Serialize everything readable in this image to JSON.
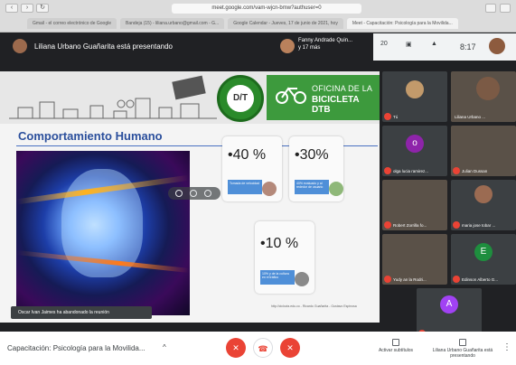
{
  "browser": {
    "url": "meet.google.com/vam-wjcn-bmw?authuser=0",
    "tabs": [
      "Gmail - el correo electrónico de Google",
      "Bandeja (15) - liliana.urbano@gmail.com - G...",
      "Google Calendar - Jueves, 17 de junio de 2021, hoy",
      "Meet - Capacitación: Psicología para la Movilida..."
    ]
  },
  "meet_top": {
    "presenting": "Liliana Urbano Guañarita está presentando",
    "others": "Fanny Andrade Quin...\ny 17 más",
    "right_count": "20",
    "time": "8:17"
  },
  "slide": {
    "office_line1": "OFICINA DE LA",
    "office_line2": "BICICLETA DTB",
    "logo": "D/T",
    "title": "Comportamiento Humano",
    "stats": [
      {
        "value": "•40 %",
        "caption": "Tomada de velocidad"
      },
      {
        "value": "•30%",
        "caption": "40% evaluado y al rededor de usuario"
      },
      {
        "value": "•10 %",
        "caption": "10% y de la cultura en el tráfico"
      }
    ],
    "credit": "http://ciclovia.edu.co - Ricardo Guañarita - Gustavo Espinosa"
  },
  "toast": "Oscar Ivan Jaimes ha abandonado la reunión",
  "participants": [
    {
      "name": "Tú",
      "type": "photo"
    },
    {
      "name": "Liliana Urbano ...",
      "type": "camera"
    },
    {
      "name": "olga lucia ramirez...",
      "type": "letter",
      "letter": "o",
      "color": "#8e24aa"
    },
    {
      "name": "Julian Dussan",
      "type": "camera"
    },
    {
      "name": "Robert Zorrilla fo...",
      "type": "camera"
    },
    {
      "name": "maria jose tobar ...",
      "type": "photo"
    },
    {
      "name": "Yudy an la Rodri...",
      "type": "camera"
    },
    {
      "name": "Edinson Alberto G...",
      "type": "letter",
      "letter": "E",
      "color": "#1e8e3e"
    },
    {
      "name": "ALEXANDRA JURADO",
      "type": "letter",
      "letter": "A",
      "color": "#a142f4"
    }
  ],
  "bottom": {
    "meeting_name": "Capacitación: Psicología para la Movilida...",
    "captions": "Activar subtítulos",
    "presenting_label": "Liliana Urbano Guañarita está presentando"
  },
  "colors": {
    "accent_red": "#ea4335",
    "title_blue": "#2b4f9c",
    "green": "#3d9a3d"
  }
}
